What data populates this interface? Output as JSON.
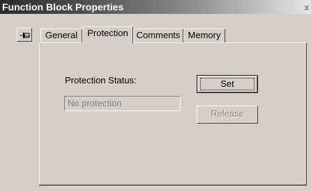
{
  "window": {
    "title": "Function Block Properties",
    "close_glyph": "x"
  },
  "pin": {
    "icon": "pushpin-icon"
  },
  "tabs": [
    {
      "label": "General",
      "active": false
    },
    {
      "label": "Protection",
      "active": true
    },
    {
      "label": "Comments",
      "active": false
    },
    {
      "label": "Memory",
      "active": false
    }
  ],
  "protection": {
    "status_label": "Protection Status:",
    "status_value": "No protection",
    "set_label": "Set",
    "release_label": "Release"
  }
}
